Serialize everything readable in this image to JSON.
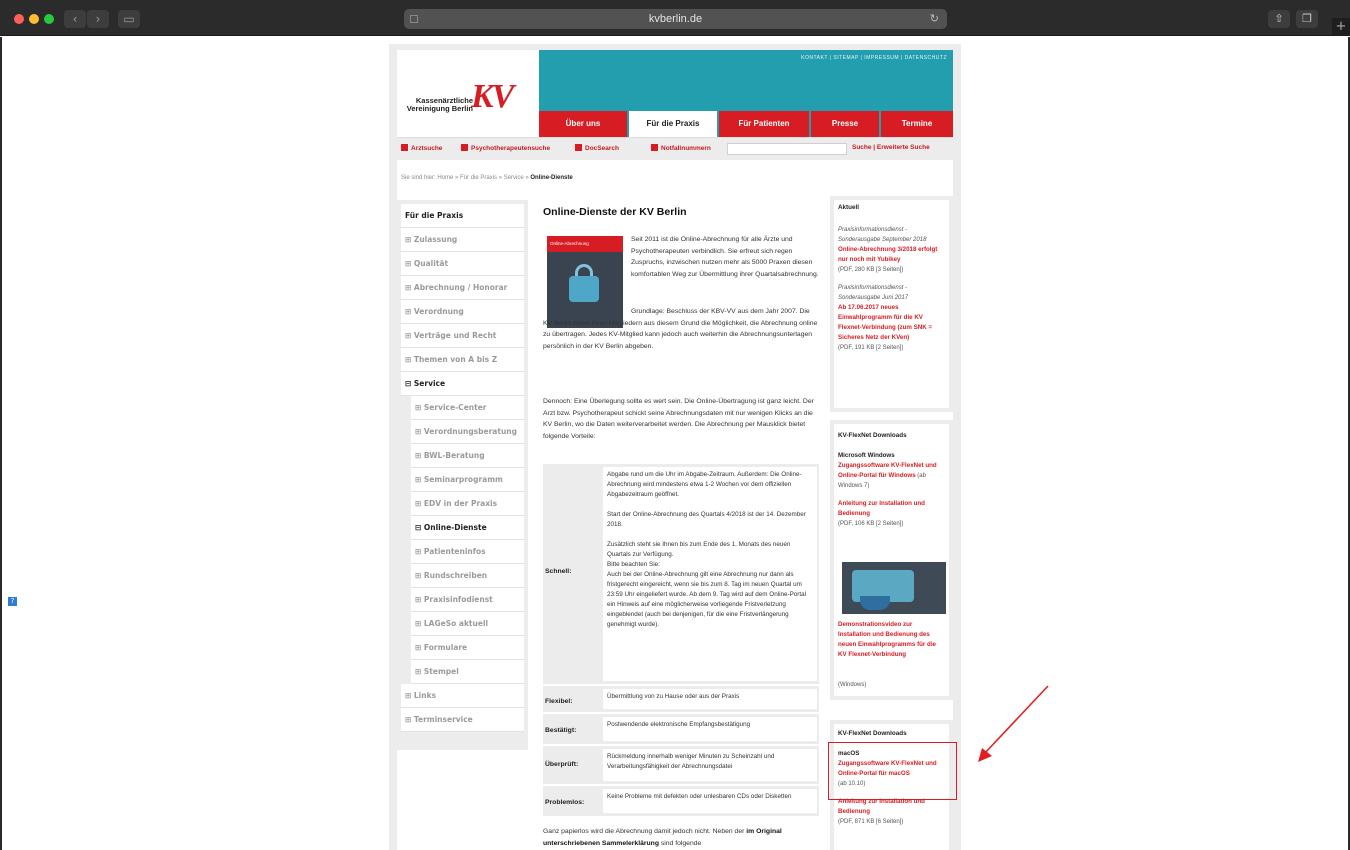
{
  "browser": {
    "url": "kvberlin.de"
  },
  "site": {
    "logo": {
      "line1": "Kassenärztliche",
      "line2": "Vereinigung Berlin",
      "mark": "KV"
    },
    "toplinks": "KONTAKT | SITEMAP | IMPRESSUM | DATENSCHUTZ",
    "nav": [
      "Über uns",
      "Für die Praxis",
      "Für Patienten",
      "Presse",
      "Termine"
    ],
    "tools": [
      "Arztsuche",
      "Psychotherapeutensuche",
      "DocSearch",
      "Notfallnummern"
    ],
    "search_links": "Suche | Erweiterte Suche",
    "breadcrumb_prefix": "Sie sind hier: Home » Für die Praxis » Service » ",
    "breadcrumb_current": "Online-Dienste"
  },
  "leftnav": {
    "title": "Für die Praxis",
    "items": [
      {
        "label": "⊞ Zulassung",
        "type": "top"
      },
      {
        "label": "⊞ Qualität",
        "type": "top"
      },
      {
        "label": "⊞ Abrechnung / Honorar",
        "type": "top"
      },
      {
        "label": "⊞ Verordnung",
        "type": "top"
      },
      {
        "label": "⊞ Verträge und Recht",
        "type": "top"
      },
      {
        "label": "⊞ Themen von A bis Z",
        "type": "top"
      },
      {
        "label": "⊟ Service",
        "type": "strong"
      },
      {
        "label": "⊞ Service-Center",
        "type": "sub"
      },
      {
        "label": "⊞ Verordnungsberatung",
        "type": "sub"
      },
      {
        "label": "⊞ BWL-Beratung",
        "type": "sub"
      },
      {
        "label": "⊞ Seminarprogramm",
        "type": "sub"
      },
      {
        "label": "⊞ EDV in der Praxis",
        "type": "sub"
      },
      {
        "label": "⊟ Online-Dienste",
        "type": "substrong"
      },
      {
        "label": "⊞ Patienteninfos",
        "type": "sub"
      },
      {
        "label": "⊞ Rundschreiben",
        "type": "sub"
      },
      {
        "label": "⊞ Praxisinfodienst",
        "type": "sub"
      },
      {
        "label": "⊞ LAGeSo aktuell",
        "type": "sub"
      },
      {
        "label": "⊞ Formulare",
        "type": "sub"
      },
      {
        "label": "⊞ Stempel",
        "type": "sub"
      },
      {
        "label": "⊞ Links",
        "type": "top"
      },
      {
        "label": "⊞ Terminservice",
        "type": "top"
      }
    ]
  },
  "main": {
    "title": "Online-Dienste der KV Berlin",
    "image_caption": "Online-Abrechnung",
    "p1": "Seit 2011 ist die Online-Abrechnung für alle Ärzte und Psychotherapeuten verbindlich. Sie erfreut sich regen Zuspruchs, inzwischen nutzen mehr als 5000 Praxen diesen komfortablen Weg zur Übermittlung ihrer Quartalsabrechnung.",
    "p2": "Grundlage: Beschluss der KBV-VV aus dem Jahr 2007. Die KV Berlin bietet ihren Mitgliedern aus diesem Grund die Möglichkeit, die Abrechnung online zu übertragen. Jedes KV-Mitglied kann jedoch auch weiterhin die Abrechnungsunterlagen persönlich in der KV Berlin abgeben.",
    "p3": "Dennoch: Eine Überlegung sollte es wert sein. Die Online-Übertragung ist ganz leicht. Der Arzt bzw. Psychotherapeut schickt seine Abrechnungsdaten mit nur wenigen Klicks an die KV Berlin, wo die Daten weiterverarbeitet werden. Die Abrechnung per Mausklick bietet folgende Vorteile:",
    "advantages": [
      {
        "label": "Schnell:",
        "text": "Abgabe rund um die Uhr im Abgabe-Zeitraum. Außerdem: Die Online-Abrechnung wird mindestens etwa 1-2 Wochen vor dem offiziellen Abgabezeitraum geöffnet.\n\nStart der Online-Abrechnung des Quartals 4/2018 ist der 14. Dezember 2018.\n\nZusätzlich steht sie Ihnen bis zum Ende des 1. Monats des neuen Quartals zur Verfügung.\nBitte beachten Sie:\nAuch bei der Online-Abrechnung gilt eine Abrechnung nur dann als fristgerecht eingereicht, wenn sie bis zum 8. Tag im neuen Quartal um 23:59 Uhr eingeliefert wurde. Ab dem 9. Tag wird auf dem Online-Portal ein Hinweis auf eine möglicherweise vorliegende Fristverletzung eingeblendet (auch bei denjenigen, für die eine Fristverlängerung genehmigt wurde)."
      },
      {
        "label": "Flexibel:",
        "text": "Übermittlung von zu Hause oder aus der Praxis"
      },
      {
        "label": "Bestätigt:",
        "text": "Postwendende elektronische Empfangsbestätigung"
      },
      {
        "label": "Überprüft:",
        "text": "Rückmeldung innerhalb weniger Minuten zu Scheinzahl und Verarbeitungsfähigkeit der Abrechnungsdatei"
      },
      {
        "label": "Problemlos:",
        "text": "Keine Probleme mit defekten oder unlesbaren CDs oder Disketten"
      }
    ],
    "p4a": "Ganz papierlos wird die Abrechnung damit jedoch nicht. Neben der ",
    "p4b": "im Original unterschriebenen Sammelerklärung",
    "p4c": " sind folgende"
  },
  "right": {
    "aktuell_title": "Aktuell",
    "a1_it": "Praxisinformationsdienst - Sonderausgabe September 2018",
    "a1_red": "Online-Abrechnung 3/2018 erfolgt nur noch mit Yubikey",
    "a1_gray": "(PDF, 280 KB [3 Seiten])",
    "a2_it": "Praxisinformationsdienst - Sonderausgabe Juni 2017",
    "a2_red": "Ab 17.06.2017 neues Einwahlprogramm für die KV Flexnet-Verbindung (zum SNK = Sicheres Netz der KVen)",
    "a2_gray": "(PDF, 191 KB [2 Seiten])",
    "dl1_title": "KV-FlexNet Downloads",
    "dl1_os": "Microsoft Windows",
    "dl1_red": "Zugangssoftware KV-FlexNet und Online-Portal für Windows",
    "dl1_after": " (ab Windows 7)",
    "dl1_red2": "Anleitung zur Installation und Bedienung",
    "dl1_gray2": "(PDF, 106 KB [2 Seiten])",
    "dl1_red3": "Demonstrationsvideo zur Installation und Bedienung des neuen Einwahlprogramms für die KV Flexnet-Verbindung",
    "dl1_gray3": "(Windows)",
    "dl2_title": "KV-FlexNet Downloads",
    "dl2_os": "macOS",
    "dl2_red": "Zugangssoftware KV-FlexNet und Online-Portal für macOS",
    "dl2_gray": "(ab 10.10)",
    "dl2_red2": "Anleitung zur Installation und Bedienung",
    "dl2_gray2": "(PDF, 871 KB [6 Seiten])"
  },
  "colors": {
    "brand_red": "#d71d23",
    "brand_teal": "#239eae"
  }
}
